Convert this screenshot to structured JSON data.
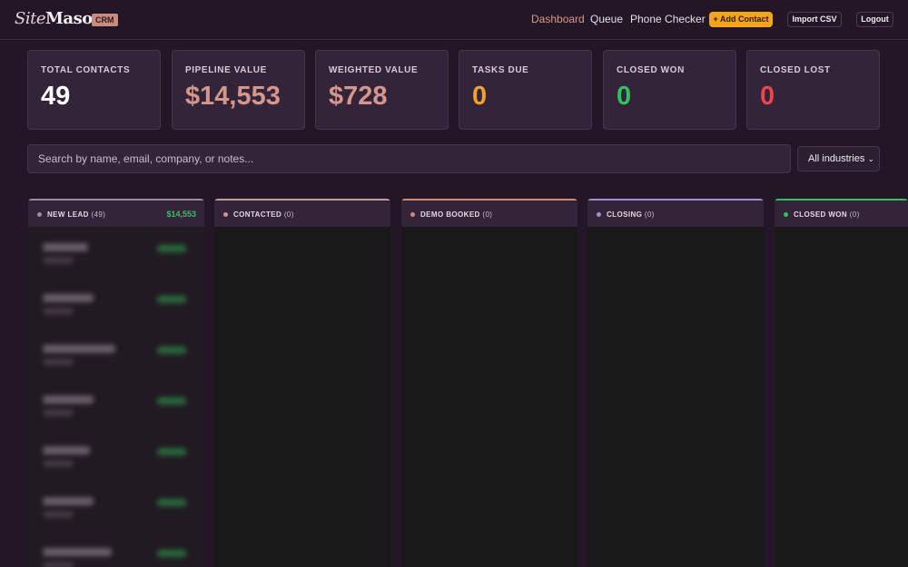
{
  "header": {
    "logo_part1": "Site",
    "logo_part2": "Mason",
    "badge": "CRM",
    "nav": [
      "Dashboard",
      "Queue",
      "Phone Checker"
    ],
    "add_contact": "+ Add Contact",
    "import_csv": "Import CSV",
    "logout": "Logout"
  },
  "stats": [
    {
      "label": "TOTAL CONTACTS",
      "value": "49",
      "color": "#ffffff"
    },
    {
      "label": "PIPELINE VALUE",
      "value": "$14,553",
      "color": "#d6968a"
    },
    {
      "label": "WEIGHTED VALUE",
      "value": "$728",
      "color": "#d6968a"
    },
    {
      "label": "TASKS DUE",
      "value": "0",
      "color": "#f0a22b"
    },
    {
      "label": "CLOSED WON",
      "value": "0",
      "color": "#2fc25e"
    },
    {
      "label": "CLOSED LOST",
      "value": "0",
      "color": "#e8454e"
    }
  ],
  "search": {
    "placeholder": "Search by name, email, company, or notes...",
    "industry": "All industries"
  },
  "columns": [
    {
      "title": "NEW LEAD",
      "count": "(49)",
      "total": "$14,553",
      "color": "#9a8e9a"
    },
    {
      "title": "CONTACTED",
      "count": "(0)",
      "total": "",
      "color": "#c49aa3"
    },
    {
      "title": "DEMO BOOKED",
      "count": "(0)",
      "total": "",
      "color": "#d68a6e"
    },
    {
      "title": "CLOSING",
      "count": "(0)",
      "total": "",
      "color": "#a98bd8"
    },
    {
      "title": "CLOSED WON",
      "count": "(0)",
      "total": "",
      "color": "#2fc25e"
    }
  ]
}
